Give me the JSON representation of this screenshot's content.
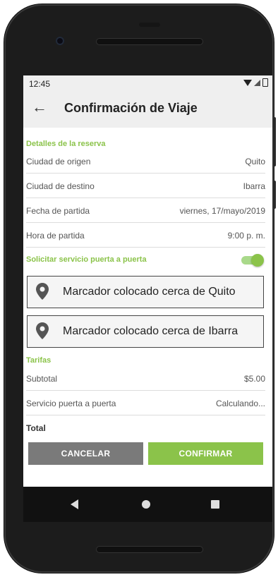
{
  "status": {
    "time": "12:45"
  },
  "appbar": {
    "back_icon": "←",
    "title": "Confirmación de Viaje"
  },
  "booking": {
    "section_label": "Detalles de la reserva",
    "rows": [
      {
        "label": "Ciudad de origen",
        "value": "Quito"
      },
      {
        "label": "Ciudad de destino",
        "value": "Ibarra"
      },
      {
        "label": "Fecha de partida",
        "value": "viernes, 17/mayo/2019"
      },
      {
        "label": "Hora de partida",
        "value": "9:00 p. m."
      }
    ]
  },
  "door_service": {
    "label": "Solicitar servicio puerta a puerta",
    "enabled": true
  },
  "markers": [
    {
      "text": "Marcador colocado cerca de Quito"
    },
    {
      "text": "Marcador colocado cerca de Ibarra"
    }
  ],
  "fares": {
    "section_label": "Tarifas",
    "rows": [
      {
        "label": "Subtotal",
        "value": "$5.00"
      },
      {
        "label": "Servicio puerta a puerta",
        "value": "Calculando..."
      }
    ],
    "total_label": "Total"
  },
  "actions": {
    "cancel": "CANCELAR",
    "confirm": "CONFIRMAR"
  },
  "colors": {
    "accent": "#8bc34a",
    "cancel": "#7a7a7a",
    "appbar": "#efefef"
  }
}
